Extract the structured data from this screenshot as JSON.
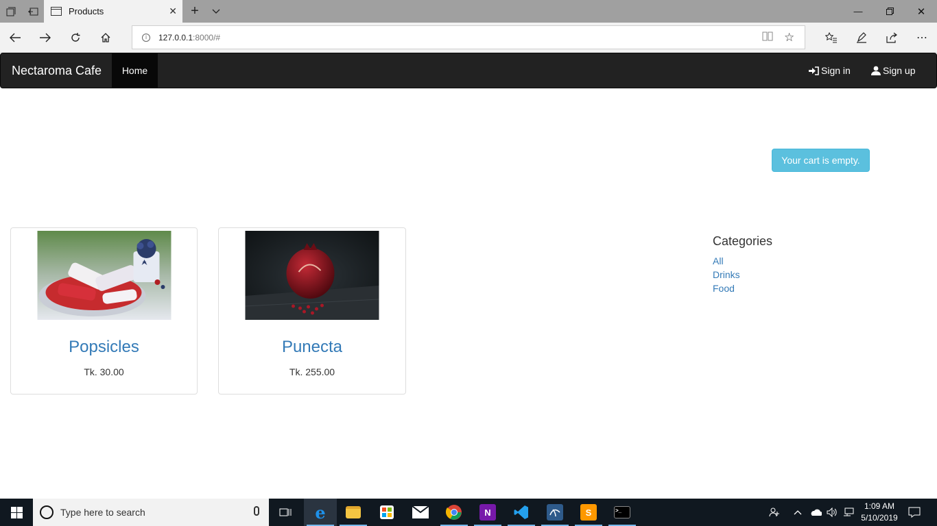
{
  "browser": {
    "tab_title": "Products",
    "url_host": "127.0.0.1",
    "url_rest": ":8000/#"
  },
  "navbar": {
    "brand": "Nectaroma Cafe",
    "home": "Home",
    "sign_in": "Sign in",
    "sign_up": "Sign up"
  },
  "cart": {
    "message": "Your cart is empty."
  },
  "products": [
    {
      "name": "Popsicles",
      "price": "Tk. 30.00"
    },
    {
      "name": "Punecta",
      "price": "Tk. 255.00"
    }
  ],
  "categories": {
    "title": "Categories",
    "items": [
      "All",
      "Drinks",
      "Food"
    ]
  },
  "taskbar": {
    "search_placeholder": "Type here to search",
    "time": "1:09 AM",
    "date": "5/10/2019"
  },
  "colors": {
    "navbar_bg": "#222222",
    "link": "#337ab7",
    "cart_info": "#5bc0de",
    "taskbar_bg": "#101820"
  }
}
